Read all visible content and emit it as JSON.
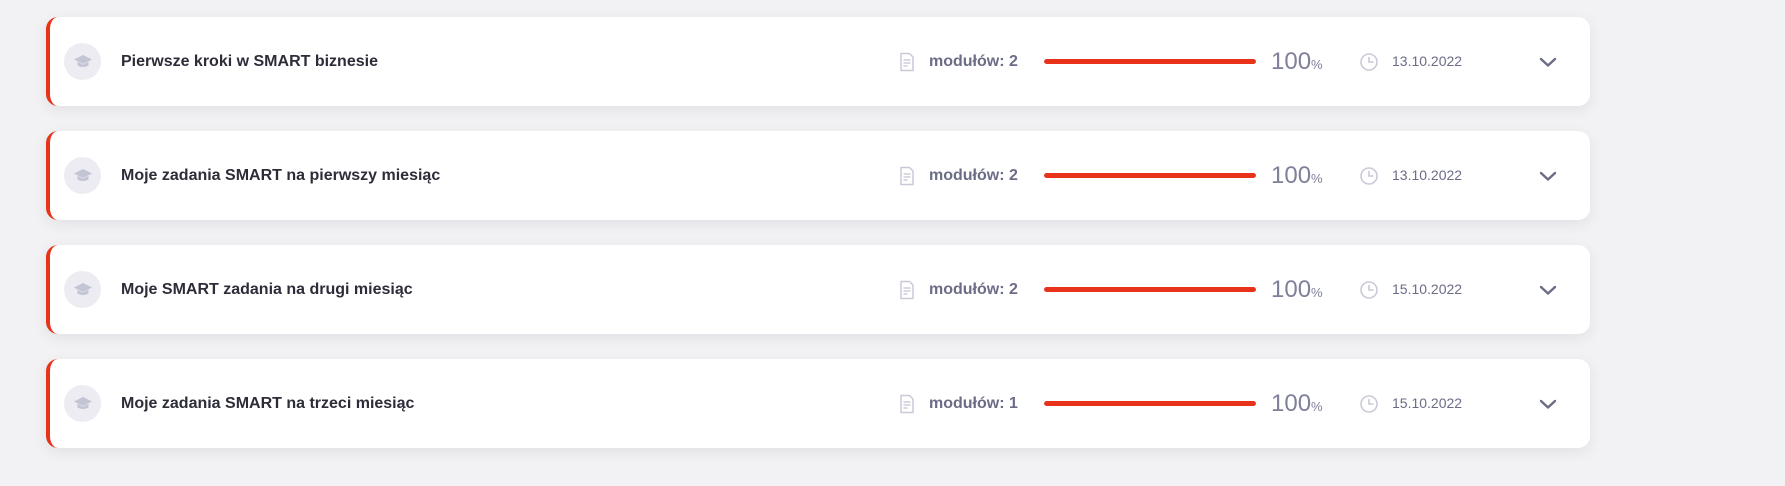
{
  "courses": [
    {
      "title": "Pierwsze kroki w SMART biznesie",
      "modules_label": "modułów: 2",
      "progress_value": "100",
      "progress_unit": "%",
      "progress_fraction": 1.0,
      "date": "13.10.2022"
    },
    {
      "title": "Moje zadania SMART na pierwszy miesiąc",
      "modules_label": "modułów: 2",
      "progress_value": "100",
      "progress_unit": "%",
      "progress_fraction": 1.0,
      "date": "13.10.2022"
    },
    {
      "title": "Moje SMART zadania na drugi miesiąc",
      "modules_label": "modułów: 2",
      "progress_value": "100",
      "progress_unit": "%",
      "progress_fraction": 1.0,
      "date": "15.10.2022"
    },
    {
      "title": "Moje zadania SMART na trzeci miesiąc",
      "modules_label": "modułów: 1",
      "progress_value": "100",
      "progress_unit": "%",
      "progress_fraction": 1.0,
      "date": "15.10.2022"
    }
  ],
  "icons": {
    "course": "graduation-cap-icon",
    "modules": "document-edit-icon",
    "date": "clock-icon",
    "expand": "chevron-down-icon"
  },
  "colors": {
    "accent": "#e8321a",
    "text_dark": "#2d2d3a",
    "text_muted": "#6b6c86",
    "icon_muted": "#c9cad8",
    "background": "#f2f2f4"
  }
}
